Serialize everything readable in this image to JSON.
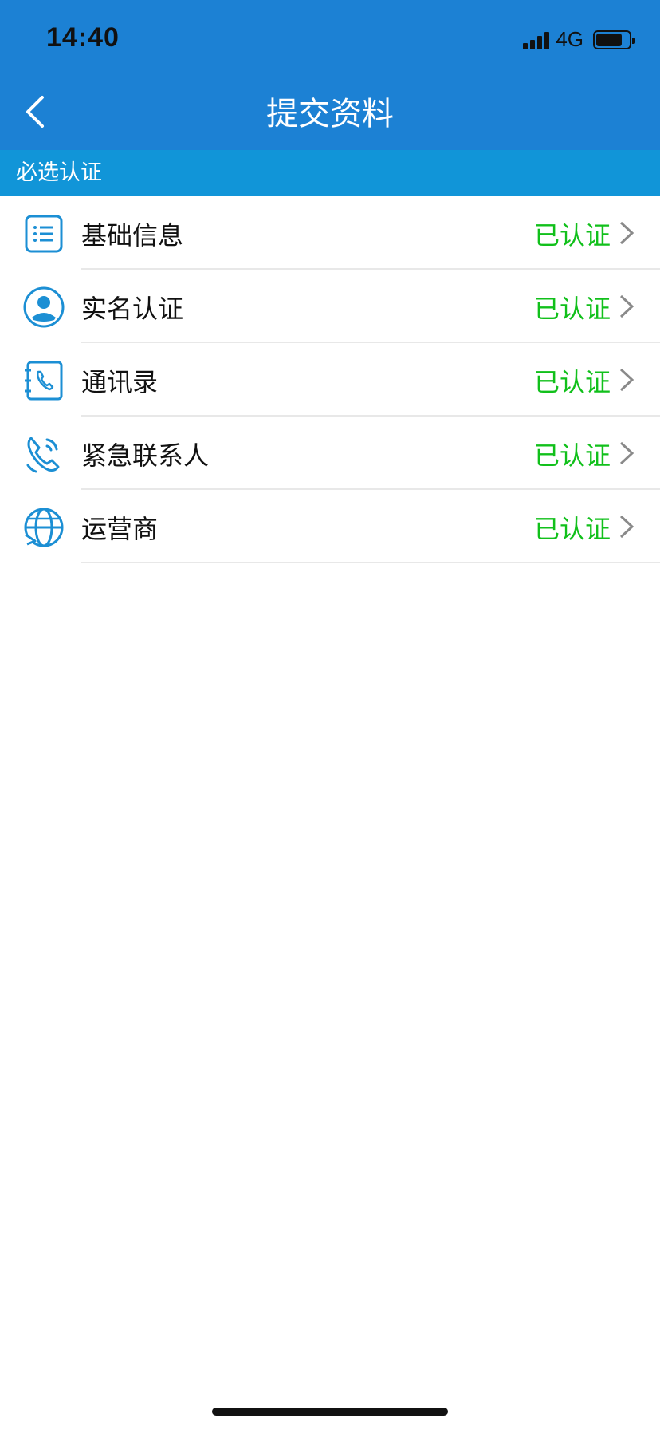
{
  "status_bar": {
    "time": "14:40",
    "network": "4G",
    "battery_level": 0.8
  },
  "nav": {
    "title": "提交资料",
    "back_icon": "chevron-left-icon"
  },
  "section": {
    "title": "必选认证"
  },
  "items": [
    {
      "label": "基础信息",
      "status": "已认证",
      "icon": "list-icon"
    },
    {
      "label": "实名认证",
      "status": "已认证",
      "icon": "user-icon"
    },
    {
      "label": "通讯录",
      "status": "已认证",
      "icon": "phone-book-icon"
    },
    {
      "label": "紧急联系人",
      "status": "已认证",
      "icon": "emergency-phone-icon"
    },
    {
      "label": "运营商",
      "status": "已认证",
      "icon": "globe-icon"
    }
  ],
  "colors": {
    "header_bg": "#1C81D4",
    "section_bg": "#1195D8",
    "status_green": "#11C01B",
    "icon_blue": "#1C8FD4"
  }
}
